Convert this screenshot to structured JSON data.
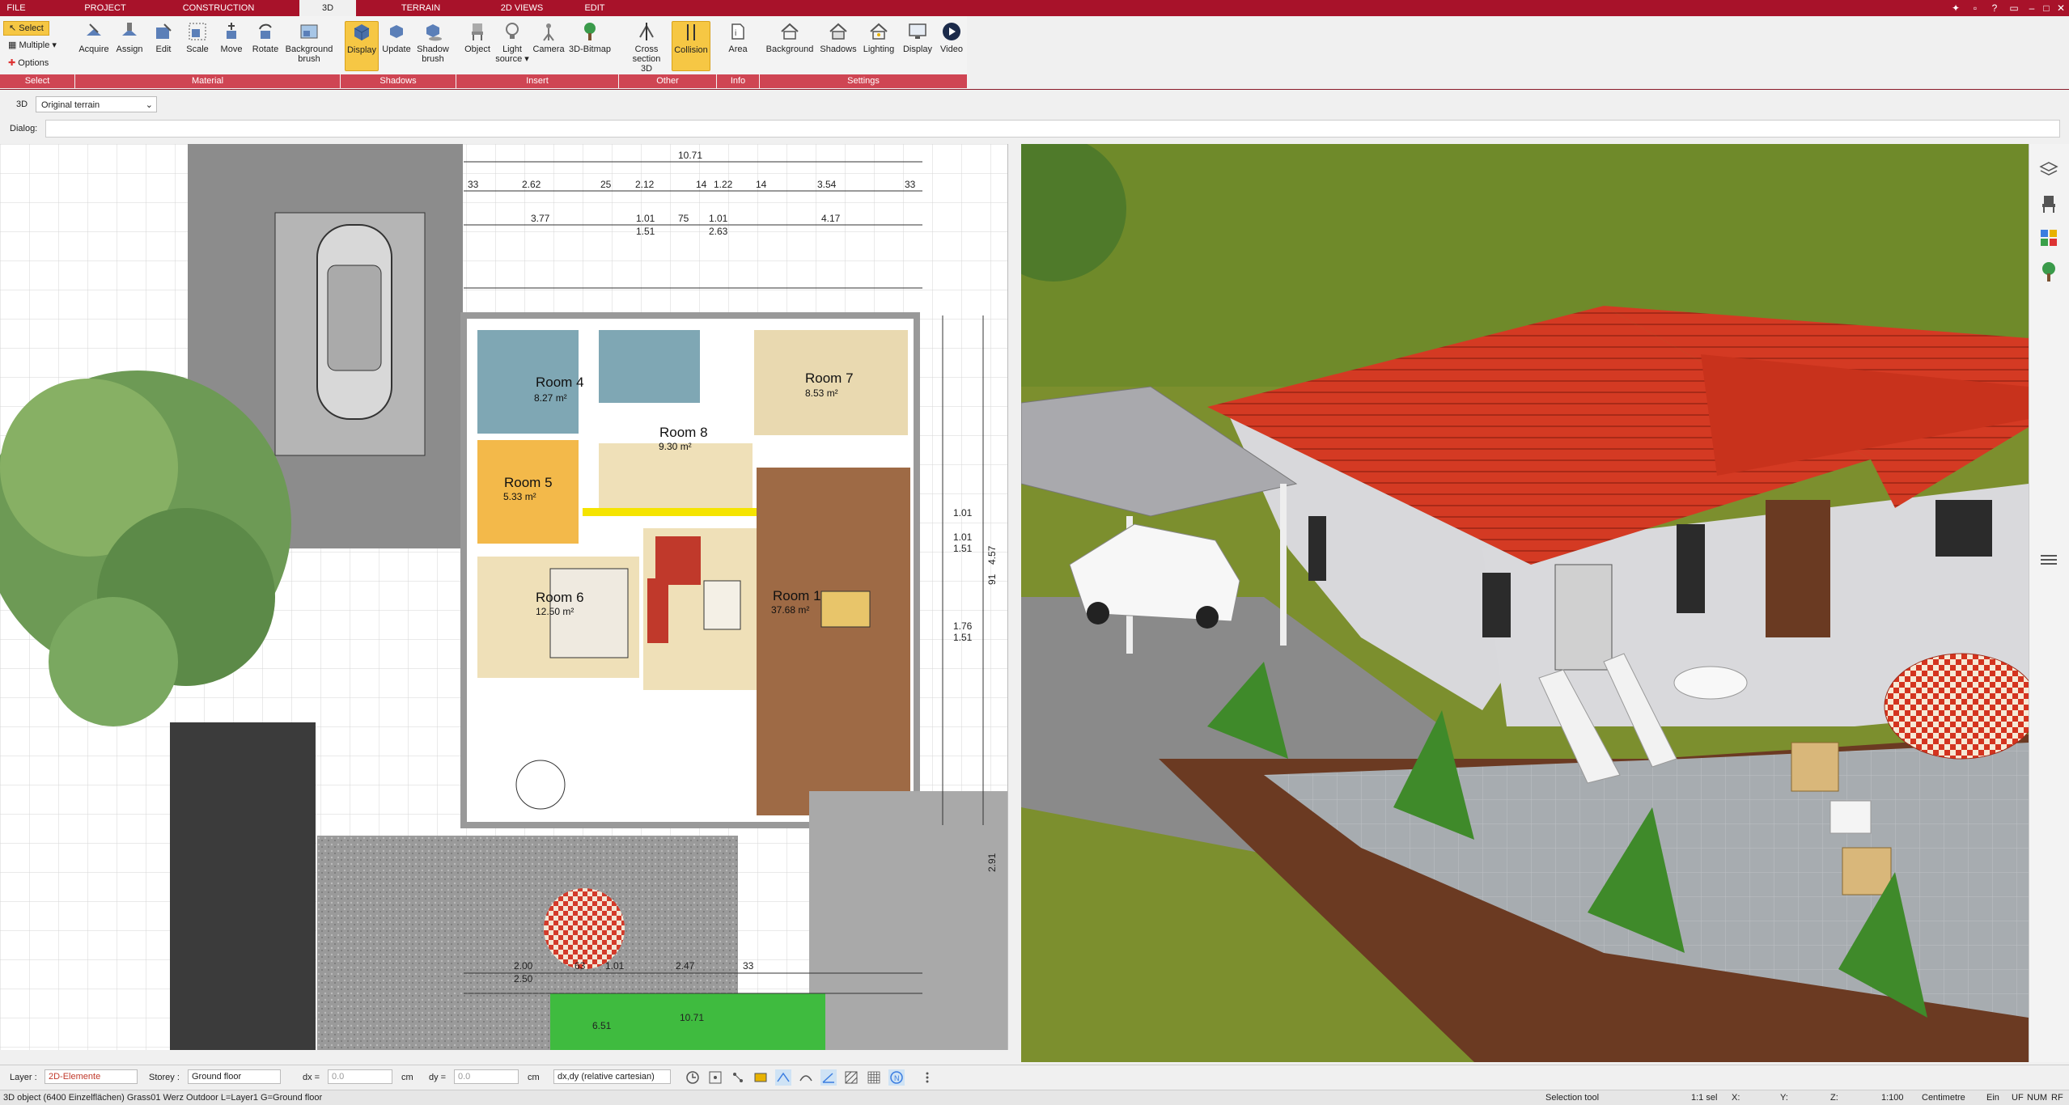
{
  "tabs": [
    "FILE",
    "PROJECT",
    "CONSTRUCTION",
    "3D",
    "TERRAIN",
    "2D VIEWS",
    "EDIT"
  ],
  "active_tab": "3D",
  "ribbon": {
    "select_label": "Select",
    "multiple_label": "Multiple",
    "options_label": "Options",
    "buttons": {
      "acquire": "Acquire",
      "assign": "Assign",
      "edit": "Edit",
      "scale": "Scale",
      "move": "Move",
      "rotate": "Rotate",
      "background_brush_1": "Background",
      "background_brush_2": "brush",
      "display": "Display",
      "update": "Update",
      "shadow_brush_1": "Shadow",
      "shadow_brush_2": "brush",
      "object": "Object",
      "light_source_1": "Light",
      "light_source_2": "source",
      "camera": "Camera",
      "bitmap": "3D-Bitmap",
      "cross_section_1": "Cross",
      "cross_section_2": "section 3D",
      "collision": "Collision",
      "area": "Area",
      "background": "Background",
      "shadows": "Shadows",
      "lighting": "Lighting",
      "display2": "Display",
      "video": "Video"
    },
    "groups": [
      "Select",
      "Material",
      "Shadows",
      "Insert",
      "Other",
      "Info",
      "Settings"
    ]
  },
  "view_selector": {
    "label": "3D",
    "value": "Original terrain"
  },
  "dialog_label": "Dialog:",
  "plan": {
    "dims_top": [
      "10.71",
      "33",
      "2.62",
      "25",
      "2.12",
      "14",
      "1.22",
      "14",
      "3.54",
      "33",
      "3.77",
      "1.01",
      "75",
      "1.01",
      "4.17",
      "1.51",
      "2.63"
    ],
    "rooms": [
      {
        "name": "Room 4",
        "area": "8.27 m²"
      },
      {
        "name": "Room 7",
        "area": "8.53 m²"
      },
      {
        "name": "Room 8",
        "area": "9.30 m²"
      },
      {
        "name": "Room 5",
        "area": "5.33 m²"
      },
      {
        "name": "Room 6",
        "area": "12.50 m²"
      },
      {
        "name": "Room 1",
        "area": "37.68 m²"
      }
    ],
    "dims_bottom": [
      "2.00",
      "2.50",
      "63",
      "1.01",
      "2.47",
      "33",
      "10.71",
      "6.51"
    ],
    "dims_right": [
      "4.57",
      "1.01",
      "1.01",
      "1.51",
      "91",
      "1.76",
      "1.51",
      "2.91"
    ]
  },
  "bottom": {
    "layer_label": "Layer :",
    "layer_value": "2D-Elemente",
    "storey_label": "Storey :",
    "storey_value": "Ground floor",
    "dx_label": "dx =",
    "dx_value": "0.0",
    "dy_label": "dy =",
    "dy_value": "0.0",
    "unit": "cm",
    "coord_mode": "dx,dy (relative cartesian)"
  },
  "status": {
    "object_info": "3D object (6400 Einzelflächen) Grass01 Werz Outdoor L=Layer1 G=Ground floor",
    "tool": "Selection tool",
    "sel": "1:1 sel",
    "x": "X:",
    "y": "Y:",
    "z": "Z:",
    "scale": "1:100",
    "unit": "Centimetre",
    "ein": "Ein",
    "uf": "UF",
    "num": "NUM",
    "rf": "RF"
  },
  "colors": {
    "accent": "#a8122a",
    "group": "#cf4553",
    "selected": "#f6c744",
    "roof": "#d43a23"
  }
}
